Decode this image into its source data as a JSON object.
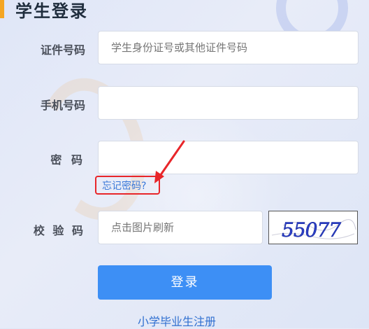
{
  "header": {
    "title": "学生登录"
  },
  "form": {
    "id_label": "证件号码",
    "id_placeholder": "学生身份证号或其他证件号码",
    "phone_label": "手机号码",
    "phone_value": "",
    "password_label": "密 码",
    "password_value": "",
    "forgot_link": "忘记密码?",
    "captcha_label": "校 验 码",
    "captcha_placeholder": "点击图片刷新",
    "captcha_image_text": "55077",
    "login_button": "登录",
    "register_link": "小学毕业生注册"
  },
  "colors": {
    "accent_bar": "#f5a623",
    "primary": "#3d8ff5",
    "highlight": "#e8262a",
    "link": "#3a78d8"
  }
}
